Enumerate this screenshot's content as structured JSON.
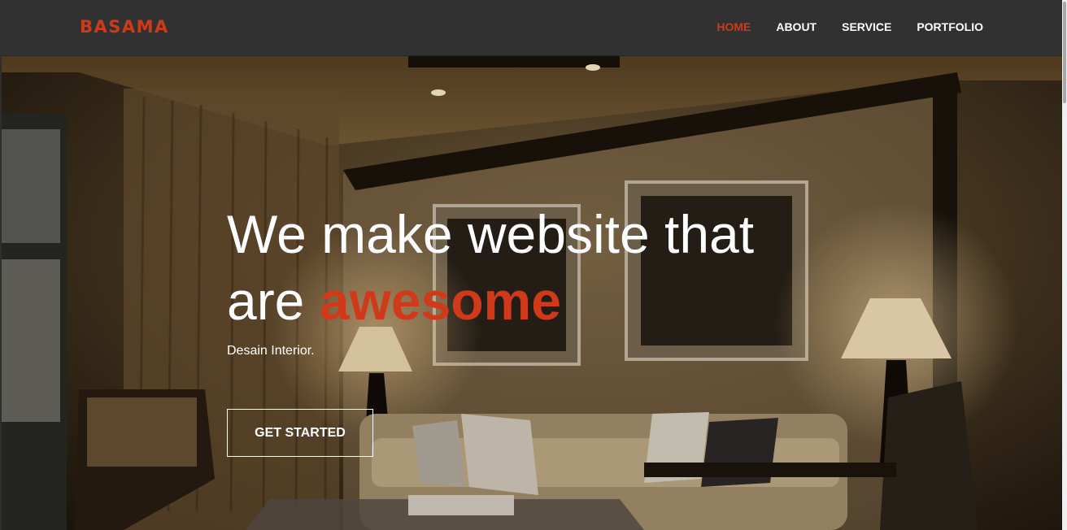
{
  "brand": {
    "logo": "BASAMA",
    "accent_color": "#cf3a1a"
  },
  "nav": {
    "items": [
      {
        "label": "HOME",
        "active": true
      },
      {
        "label": "ABOUT",
        "active": false
      },
      {
        "label": "SERVICE",
        "active": false
      },
      {
        "label": "PORTFOLIO",
        "active": false
      }
    ]
  },
  "hero": {
    "headline_line1": "We make website that",
    "headline_line2_prefix": "are ",
    "headline_accent": "awesome",
    "subtitle": "Desain Interior.",
    "cta_label": "GET STARTED",
    "background": "living-room-interior-photo"
  }
}
